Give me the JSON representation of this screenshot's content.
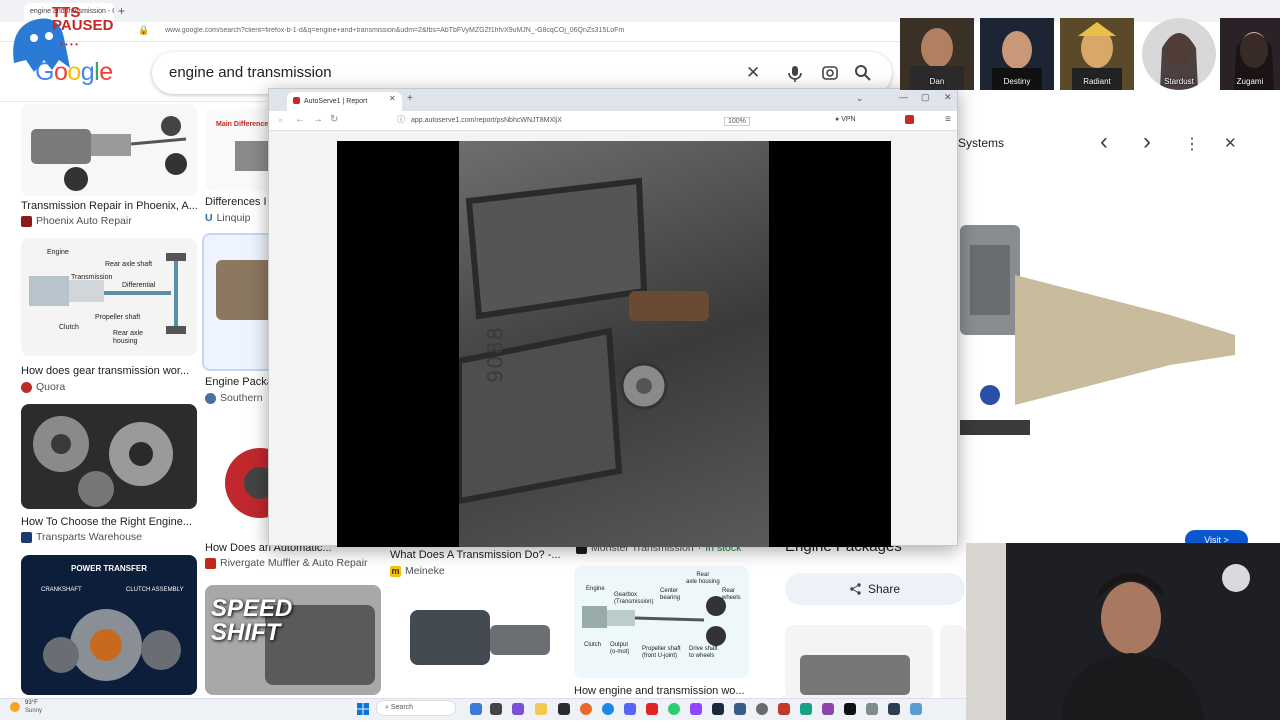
{
  "browser": {
    "tab_title": "engine and transmission - Google Search",
    "new_tab": "+",
    "url": "www.google.com/search?client=firefox-b-1-d&q=engine+and+transmission&udm=2&fbs=AbTbFVyMZGZf1hfvX9uMJN_-G8cqCOj_06QnZs315LoFm",
    "lock_icon": "🔒"
  },
  "overlay": {
    "tts_status": "TTS\nPAUSED",
    "dots": "• • • •"
  },
  "google": {
    "logo": [
      "G",
      "o",
      "o",
      "g",
      "l",
      "e"
    ],
    "logo_colors": [
      "#4285f4",
      "#ea4335",
      "#fbbc05",
      "#4285f4",
      "#34a853",
      "#ea4335"
    ],
    "query": "engine and transmission",
    "clear_icon": "✕",
    "mic_icon": "🎤",
    "lens_icon": "⊙",
    "search_icon": "⌕"
  },
  "results": [
    {
      "title": "Transmission Repair in Phoenix, A...",
      "source": "Phoenix Auto Repair",
      "fav_color": "#8b1a1a"
    },
    {
      "title": "Differences I",
      "source": "Linquip",
      "fav_color": "#2b6cb0",
      "fav_text": "U"
    },
    {
      "title": "How does gear transmission wor...",
      "source": "Quora",
      "fav_color": "#b92b27",
      "fav_text": "Q"
    },
    {
      "title": "Engine Packa",
      "source": "Southern",
      "fav_color": "#4a6fa5"
    },
    {
      "title": "How To Choose the Right Engine...",
      "source": "Transparts Warehouse",
      "fav_color": "#1c3a6e"
    },
    {
      "title": "How Does an Automatic...",
      "source": "Rivergate Muffler & Auto Repair",
      "fav_color": "#c2271c"
    },
    {
      "title": "What Does A Transmission Do? -...",
      "source": "Meineke",
      "fav_color": "#f5c400",
      "fav_text": "m"
    },
    {
      "title": "Monster Transmission",
      "source_extra": "In stock",
      "fav_color": "#1c1c1c"
    },
    {
      "title": "How engine and transmission wo...",
      "source": "",
      "fav_color": "#888"
    }
  ],
  "diagram1": {
    "labels": [
      "Engine",
      "Transmission",
      "Rear axle shaft",
      "Differential",
      "Propeller shaft",
      "Clutch",
      "Rear axle\nhousing"
    ]
  },
  "diagram2": {
    "labels": [
      "Rear\naxle housing",
      "Engine",
      "Gearbox\n(Transmission)",
      "Center\nbearing",
      "Rear\nwheels",
      "Clutch",
      "Output\n(o-mot)",
      "Propeller shaft\n(front U-joint)",
      "Drive shaft\nto wheels"
    ]
  },
  "power_transfer": {
    "title": "POWER TRANSFER",
    "left": "CRANKSHAFT",
    "right": "CLUTCH ASSEMBLY"
  },
  "speed_shift": "SPEED\nSHIFT",
  "small_label": "Main Differences",
  "popup": {
    "tab_title": "AutoServe1 | Report",
    "url": "app.autoserve1.com/report/psNbhcWNJT8MXljX",
    "zoom": "100%",
    "vpn": "VPN",
    "photo_text": "9088"
  },
  "rpanel": {
    "title": "Systems",
    "prev_icon": "‹",
    "next_icon": "›",
    "more_icon": "⋮",
    "close_icon": "✕",
    "caption": "Engine Packages",
    "share": "Share",
    "visit": "Visit >"
  },
  "webcams": [
    {
      "name": "Dan",
      "bg": "#3a3025"
    },
    {
      "name": "Destiny",
      "bg": "#1d2433"
    },
    {
      "name": "Radiant",
      "bg": "#5a4a2a"
    },
    {
      "name": "Stardust",
      "bg": "#d8d8d8"
    },
    {
      "name": "Zugami",
      "bg": "#2a2226"
    }
  ],
  "taskbar": {
    "temp": "93°F",
    "weather": "Sunny",
    "search": "Search"
  }
}
